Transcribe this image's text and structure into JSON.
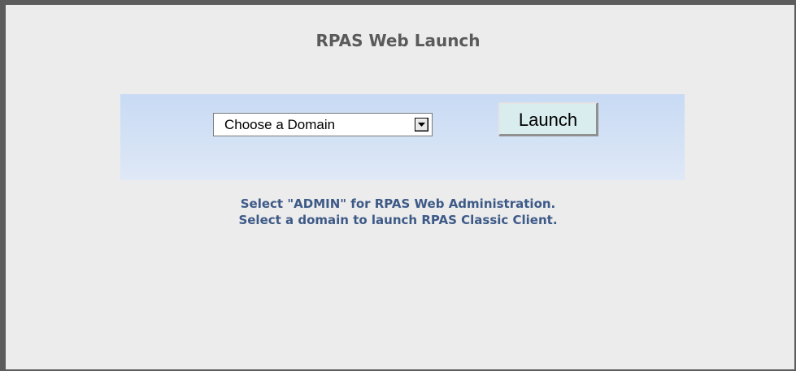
{
  "page": {
    "title": "RPAS Web Launch"
  },
  "launch_form": {
    "domain_select_value": "Choose a Domain",
    "launch_button_label": "Launch"
  },
  "help": {
    "line1": "Select \"ADMIN\" for RPAS Web Administration.",
    "line2": "Select a domain to launch RPAS Classic Client."
  },
  "icons": {
    "dropdown": "chevron-down-icon"
  },
  "colors": {
    "frame_border": "#5c5c5c",
    "background": "#ececec",
    "panel_gradient_top": "#c8daf4",
    "panel_gradient_bottom": "#dfe8f6",
    "title_text": "#5a5a5a",
    "help_text": "#3d5a87",
    "launch_button_bg": "#d9ecee"
  }
}
